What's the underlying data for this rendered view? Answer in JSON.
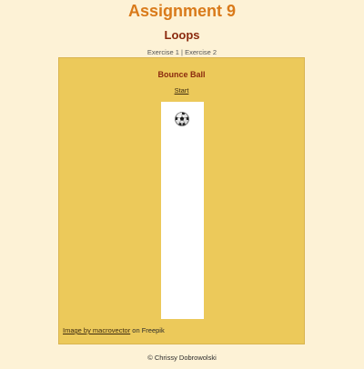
{
  "header": {
    "title": "Assignment 9",
    "subtitle": "Loops"
  },
  "nav": {
    "exercise1": "Exercise 1",
    "separator": " | ",
    "exercise2": "Exercise 2"
  },
  "panel": {
    "title": "Bounce Ball",
    "start_label": "Start",
    "ball_icon": "soccer-ball-icon",
    "credit_link": "Image by macrovector",
    "credit_suffix": " on Freepik"
  },
  "footer": {
    "copyright": "© Chrissy Dobrowolski"
  },
  "colors": {
    "page_background": "#fdf2d6",
    "title": "#d97a1a",
    "subtitle": "#8b2a0e",
    "panel_background": "#ecc95a",
    "track_background": "#ffffff"
  }
}
